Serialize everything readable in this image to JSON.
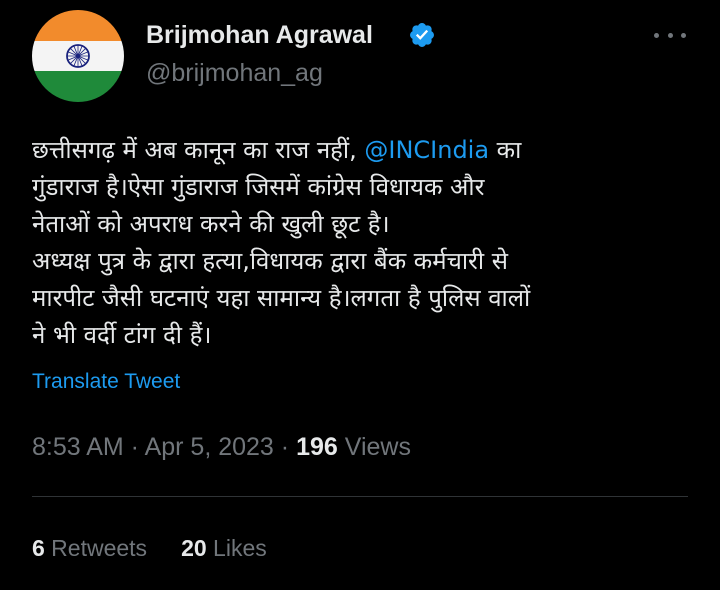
{
  "author": {
    "display_name": "Brijmohan Agrawal",
    "handle": "@brijmohan_ag",
    "avatar": "india-flag-avatar",
    "verified_icon": "verified-badge-icon"
  },
  "tweet": {
    "line1_pre": "छत्तीसगढ़ में अब कानून का राज नहीं, ",
    "mention": "@INCIndia",
    "line1_post": " का",
    "line2": "गुंडाराज है।ऐसा गुंडाराज जिसमें कांग्रेस विधायक और",
    "line3": "नेताओं को अपराध करने की खुली छूट है।",
    "line4": "अध्यक्ष पुत्र के द्वारा हत्या,विधायक द्वारा बैंक कर्मचारी से",
    "line5": "मारपीट जैसी घटनाएं यहा सामान्य है।लगता है पुलिस वालों",
    "line6": "ने भी वर्दी टांग दी हैं।"
  },
  "translate_label": "Translate Tweet",
  "meta": {
    "time": "8:53 AM",
    "separator": " · ",
    "date": "Apr 5, 2023",
    "views_count": "196",
    "views_label": " Views"
  },
  "stats": {
    "retweets_count": "6",
    "retweets_label": " Retweets",
    "likes_count": "20",
    "likes_label": " Likes"
  },
  "colors": {
    "background": "#000000",
    "text": "#e7e9ea",
    "secondary": "#71767b",
    "accent": "#1d9bf0",
    "divider": "#2f3336"
  }
}
